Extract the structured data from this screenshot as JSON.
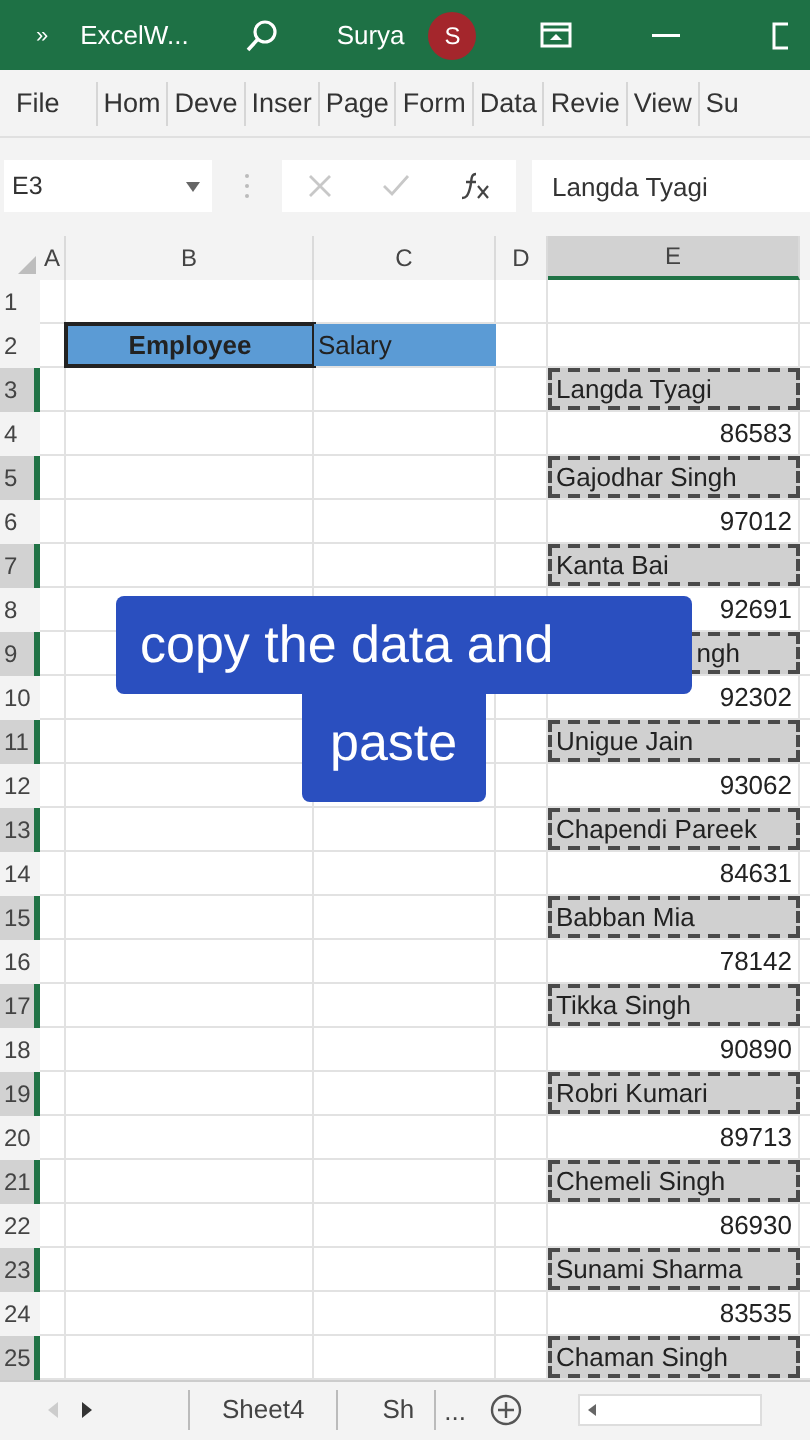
{
  "title_bar": {
    "overflow": "»",
    "file_name": "ExcelW...",
    "user": "Surya",
    "avatar": "S"
  },
  "ribbon_tabs": [
    "File",
    "Hom",
    "Deve",
    "Inser",
    "Page",
    "Form",
    "Data",
    "Revie",
    "View",
    "Su"
  ],
  "formula_bar": {
    "name_box": "E3",
    "formula": "Langda Tyagi"
  },
  "columns": [
    {
      "label": "A",
      "selected": false
    },
    {
      "label": "B",
      "selected": false
    },
    {
      "label": "C",
      "selected": false
    },
    {
      "label": "D",
      "selected": false
    },
    {
      "label": "E",
      "selected": true
    }
  ],
  "rows": [
    {
      "number": "1",
      "selected": false,
      "b": null,
      "c": null,
      "e": null
    },
    {
      "number": "2",
      "selected": false,
      "b": {
        "kind": "header_bold",
        "text": "Employee"
      },
      "c": {
        "kind": "header",
        "text": "Salary"
      },
      "e": null
    },
    {
      "number": "3",
      "selected": true,
      "b": null,
      "c": null,
      "e": {
        "kind": "name",
        "text": "Langda Tyagi"
      }
    },
    {
      "number": "4",
      "selected": false,
      "b": null,
      "c": null,
      "e": {
        "kind": "number",
        "text": "86583"
      }
    },
    {
      "number": "5",
      "selected": true,
      "b": null,
      "c": null,
      "e": {
        "kind": "name",
        "text": "Gajodhar Singh"
      }
    },
    {
      "number": "6",
      "selected": false,
      "b": null,
      "c": null,
      "e": {
        "kind": "number",
        "text": "97012"
      }
    },
    {
      "number": "7",
      "selected": true,
      "b": null,
      "c": null,
      "e": {
        "kind": "name",
        "text": "Kanta Bai"
      }
    },
    {
      "number": "8",
      "selected": false,
      "b": null,
      "c": null,
      "e": {
        "kind": "number",
        "text": "92691"
      }
    },
    {
      "number": "9",
      "selected": true,
      "b": null,
      "c": null,
      "e": {
        "kind": "name_covered",
        "text": "ngh"
      }
    },
    {
      "number": "10",
      "selected": false,
      "b": null,
      "c": null,
      "e": {
        "kind": "number",
        "text": "92302"
      }
    },
    {
      "number": "11",
      "selected": true,
      "b": null,
      "c": null,
      "e": {
        "kind": "name",
        "text": "Unigue Jain"
      }
    },
    {
      "number": "12",
      "selected": false,
      "b": null,
      "c": null,
      "e": {
        "kind": "number",
        "text": "93062"
      }
    },
    {
      "number": "13",
      "selected": true,
      "b": null,
      "c": null,
      "e": {
        "kind": "name",
        "text": "Chapendi Pareek"
      }
    },
    {
      "number": "14",
      "selected": false,
      "b": null,
      "c": null,
      "e": {
        "kind": "number",
        "text": "84631"
      }
    },
    {
      "number": "15",
      "selected": true,
      "b": null,
      "c": null,
      "e": {
        "kind": "name",
        "text": "Babban Mia"
      }
    },
    {
      "number": "16",
      "selected": false,
      "b": null,
      "c": null,
      "e": {
        "kind": "number",
        "text": "78142"
      }
    },
    {
      "number": "17",
      "selected": true,
      "b": null,
      "c": null,
      "e": {
        "kind": "name",
        "text": "Tikka Singh"
      }
    },
    {
      "number": "18",
      "selected": false,
      "b": null,
      "c": null,
      "e": {
        "kind": "number",
        "text": "90890"
      }
    },
    {
      "number": "19",
      "selected": true,
      "b": null,
      "c": null,
      "e": {
        "kind": "name",
        "text": "Robri Kumari"
      }
    },
    {
      "number": "20",
      "selected": false,
      "b": null,
      "c": null,
      "e": {
        "kind": "number",
        "text": "89713"
      }
    },
    {
      "number": "21",
      "selected": true,
      "b": null,
      "c": null,
      "e": {
        "kind": "name",
        "text": "Chemeli Singh"
      }
    },
    {
      "number": "22",
      "selected": false,
      "b": null,
      "c": null,
      "e": {
        "kind": "number",
        "text": "86930"
      }
    },
    {
      "number": "23",
      "selected": true,
      "b": null,
      "c": null,
      "e": {
        "kind": "name",
        "text": "Sunami Sharma"
      }
    },
    {
      "number": "24",
      "selected": false,
      "b": null,
      "c": null,
      "e": {
        "kind": "number",
        "text": "83535"
      }
    },
    {
      "number": "25",
      "selected": true,
      "b": null,
      "c": null,
      "e": {
        "kind": "name",
        "text": "Chaman Singh"
      }
    }
  ],
  "caption": {
    "lines": [
      "copy the data and",
      "paste"
    ]
  },
  "sheet_tabs": [
    "Sheet4",
    "Sh",
    "..."
  ]
}
